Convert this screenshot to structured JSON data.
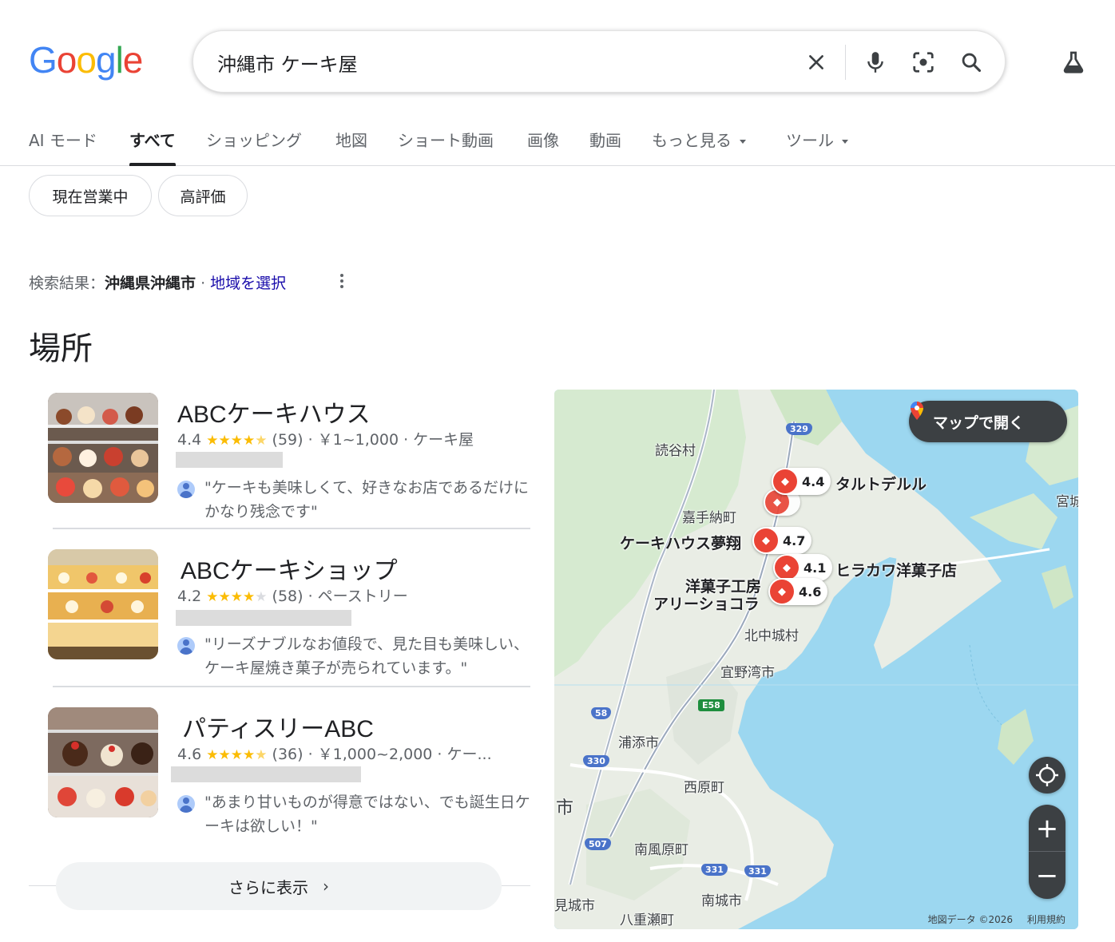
{
  "logo": {
    "letters": [
      "G",
      "o",
      "o",
      "g",
      "l",
      "e"
    ],
    "colors": [
      "#4285f4",
      "#ea4335",
      "#fbbc05",
      "#4285f4",
      "#34a853",
      "#ea4335"
    ]
  },
  "search": {
    "query": "沖縄市 ケーキ屋"
  },
  "icons": {
    "clear": "close-icon",
    "mic": "mic-icon",
    "lens": "lens-icon",
    "search": "search-icon",
    "labs": "labs-flask-icon"
  },
  "tabs": [
    {
      "label": "AI モード",
      "active": false
    },
    {
      "label": "すべて",
      "active": true
    },
    {
      "label": "ショッピング",
      "active": false
    },
    {
      "label": "地図",
      "active": false
    },
    {
      "label": "ショート動画",
      "active": false
    },
    {
      "label": "画像",
      "active": false
    },
    {
      "label": "動画",
      "active": false
    },
    {
      "label": "もっと見る",
      "active": false
    },
    {
      "label": "ツール",
      "active": false
    }
  ],
  "chips": [
    "現在営業中",
    "高評価"
  ],
  "location": {
    "prefix": "検索結果：",
    "place": "沖縄県沖縄市",
    "sep": " · ",
    "link": "地域を選択"
  },
  "section_title": "場所",
  "results": [
    {
      "name": "ABCケーキハウス",
      "rating": "4.4",
      "stars": "★★★★",
      "half": "★",
      "off": "",
      "count": "(59)",
      "info": " · ￥1~1,000 · ケーキ屋",
      "review_bold": "ケーキ",
      "review": "\"ケーキも美味しくて、好きなお店であるだけにかなり残念です\""
    },
    {
      "name": "ABCケーキショップ",
      "rating": "4.2",
      "stars": "★★★★",
      "half": "",
      "off": "★",
      "count": "(58)",
      "info": " · ペーストリー",
      "review": "\"リーズナブルなお値段で、見た目も美味しい、ケーキ屋焼き菓子が売られています。\""
    },
    {
      "name": "パティスリーABC",
      "rating": "4.6",
      "stars": "★★★★",
      "half": "★",
      "off": "",
      "count": "(36)",
      "info": " · ￥1,000~2,000 · ケー...",
      "review": "\"あまり甘いものが得意ではない、でも誕生日ケーキは欲しい！\""
    }
  ],
  "more_button": "さらに表示",
  "map": {
    "open_button": "マップで開く",
    "labels": [
      "読谷村",
      "嘉手納町",
      "北中城村",
      "宜野湾市",
      "浦添市",
      "西原町",
      "南風原町",
      "南城市",
      "八重瀬町",
      "宮城",
      "市",
      "見城市"
    ],
    "shop_labels": [
      "タルトデルル",
      "ケーキハウス夢翔",
      "ヒラカワ洋菓子店",
      "洋菓子工房",
      "アリーショコラ"
    ],
    "markers": [
      "4.4",
      "4.7",
      "4.1",
      "4.6"
    ],
    "routes": [
      "329",
      "58",
      "330",
      "507",
      "331",
      "331",
      "E58"
    ],
    "attribution": "地図データ ©2026",
    "terms": "利用規約"
  }
}
